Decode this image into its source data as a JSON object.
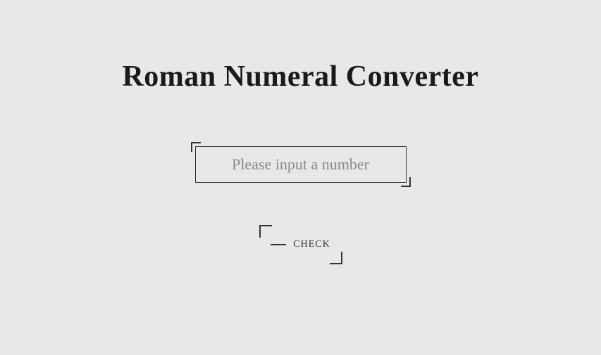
{
  "title": "Roman Numeral Converter",
  "input": {
    "placeholder": "Please input a number",
    "value": ""
  },
  "button": {
    "label": "CHECK"
  }
}
